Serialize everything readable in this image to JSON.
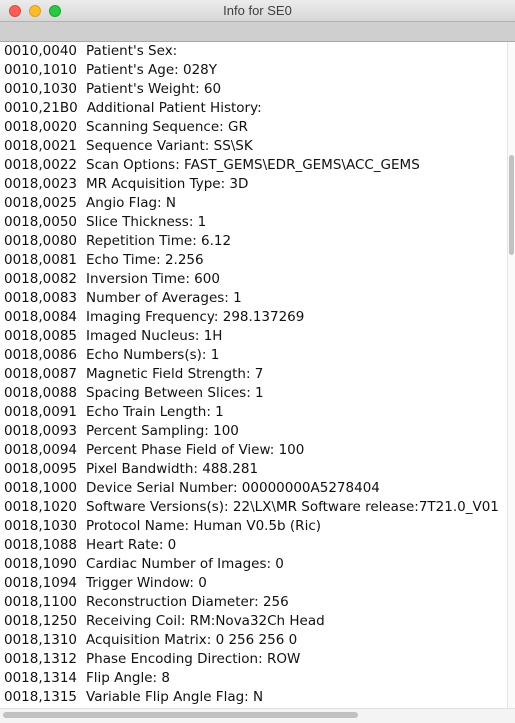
{
  "window": {
    "title": "Info for SE0"
  },
  "lines": [
    {
      "tag": "0010,0040",
      "text": "Patient's Sex:"
    },
    {
      "tag": "0010,1010",
      "text": "Patient's Age: 028Y"
    },
    {
      "tag": "0010,1030",
      "text": "Patient's Weight: 60"
    },
    {
      "tag": "0010,21B0",
      "text": "Additional Patient History:"
    },
    {
      "tag": "0018,0020",
      "text": "Scanning Sequence: GR"
    },
    {
      "tag": "0018,0021",
      "text": "Sequence Variant: SS\\SK"
    },
    {
      "tag": "0018,0022",
      "text": "Scan Options: FAST_GEMS\\EDR_GEMS\\ACC_GEMS"
    },
    {
      "tag": "0018,0023",
      "text": "MR Acquisition Type: 3D"
    },
    {
      "tag": "0018,0025",
      "text": "Angio Flag: N"
    },
    {
      "tag": "0018,0050",
      "text": "Slice Thickness: 1"
    },
    {
      "tag": "0018,0080",
      "text": "Repetition Time: 6.12"
    },
    {
      "tag": "0018,0081",
      "text": "Echo Time: 2.256"
    },
    {
      "tag": "0018,0082",
      "text": "Inversion Time: 600"
    },
    {
      "tag": "0018,0083",
      "text": "Number of Averages: 1"
    },
    {
      "tag": "0018,0084",
      "text": "Imaging Frequency: 298.137269"
    },
    {
      "tag": "0018,0085",
      "text": "Imaged Nucleus: 1H"
    },
    {
      "tag": "0018,0086",
      "text": "Echo Numbers(s): 1"
    },
    {
      "tag": "0018,0087",
      "text": "Magnetic Field Strength: 7"
    },
    {
      "tag": "0018,0088",
      "text": "Spacing Between Slices: 1"
    },
    {
      "tag": "0018,0091",
      "text": "Echo Train Length: 1"
    },
    {
      "tag": "0018,0093",
      "text": "Percent Sampling: 100"
    },
    {
      "tag": "0018,0094",
      "text": "Percent Phase Field of View: 100"
    },
    {
      "tag": "0018,0095",
      "text": "Pixel Bandwidth: 488.281"
    },
    {
      "tag": "0018,1000",
      "text": "Device Serial Number: 00000000A5278404"
    },
    {
      "tag": "0018,1020",
      "text": "Software Versions(s): 22\\LX\\MR Software release:7T21.0_V01"
    },
    {
      "tag": "0018,1030",
      "text": "Protocol Name: Human V0.5b (Ric)"
    },
    {
      "tag": "0018,1088",
      "text": "Heart Rate: 0"
    },
    {
      "tag": "0018,1090",
      "text": "Cardiac Number of Images: 0"
    },
    {
      "tag": "0018,1094",
      "text": "Trigger Window: 0"
    },
    {
      "tag": "0018,1100",
      "text": "Reconstruction Diameter: 256"
    },
    {
      "tag": "0018,1250",
      "text": "Receiving Coil: RM:Nova32Ch Head"
    },
    {
      "tag": "0018,1310",
      "text": "Acquisition Matrix: 0 256 256 0"
    },
    {
      "tag": "0018,1312",
      "text": "Phase Encoding Direction: ROW"
    },
    {
      "tag": "0018,1314",
      "text": "Flip Angle: 8"
    },
    {
      "tag": "0018,1315",
      "text": "Variable Flip Angle Flag: N"
    }
  ]
}
